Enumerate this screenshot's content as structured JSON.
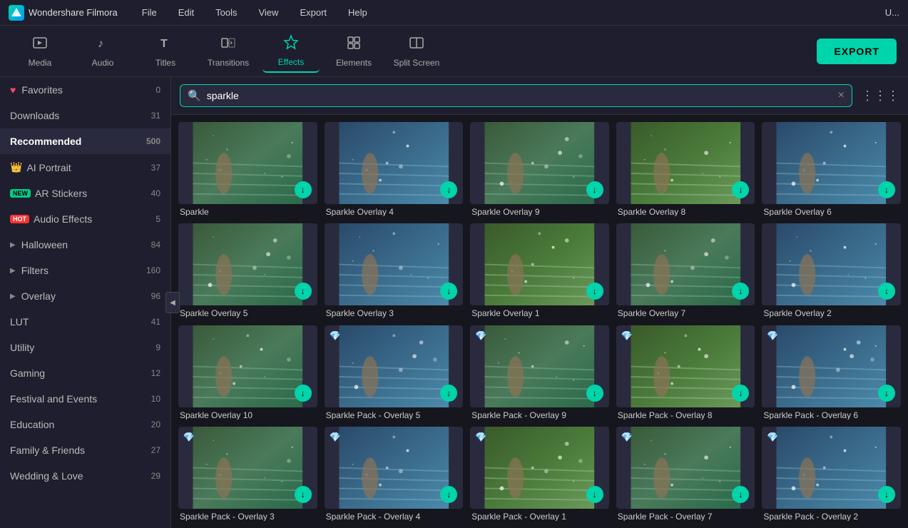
{
  "app": {
    "name": "Wondershare Filmora",
    "logo_text": "F"
  },
  "menu": {
    "items": [
      "File",
      "Edit",
      "Tools",
      "View",
      "Export",
      "Help"
    ],
    "right_text": "U..."
  },
  "tabs": [
    {
      "id": "media",
      "label": "Media",
      "icon": "📁"
    },
    {
      "id": "audio",
      "label": "Audio",
      "icon": "🎵"
    },
    {
      "id": "titles",
      "label": "Titles",
      "icon": "T"
    },
    {
      "id": "transitions",
      "label": "Transitions",
      "icon": "✦"
    },
    {
      "id": "effects",
      "label": "Effects",
      "icon": "✦",
      "active": true
    },
    {
      "id": "elements",
      "label": "Elements",
      "icon": "⊞"
    },
    {
      "id": "split_screen",
      "label": "Split Screen",
      "icon": "⊟"
    }
  ],
  "export_label": "EXPORT",
  "search": {
    "placeholder": "Search",
    "value": "sparkle",
    "clear_icon": "×",
    "grid_icon": "⋮⋮⋮"
  },
  "sidebar": {
    "items": [
      {
        "id": "favorites",
        "label": "Favorites",
        "count": "0",
        "icon_type": "heart"
      },
      {
        "id": "downloads",
        "label": "Downloads",
        "count": "31",
        "icon_type": "none"
      },
      {
        "id": "recommended",
        "label": "Recommended",
        "count": "500",
        "icon_type": "none",
        "active": true
      },
      {
        "id": "ai_portrait",
        "label": "AI Portrait",
        "count": "37",
        "icon_type": "crown"
      },
      {
        "id": "ar_stickers",
        "label": "AR Stickers",
        "count": "40",
        "icon_type": "new"
      },
      {
        "id": "audio_effects",
        "label": "Audio Effects",
        "count": "5",
        "icon_type": "hot"
      },
      {
        "id": "halloween",
        "label": "Halloween",
        "count": "84",
        "icon_type": "arrow"
      },
      {
        "id": "filters",
        "label": "Filters",
        "count": "160",
        "icon_type": "arrow"
      },
      {
        "id": "overlay",
        "label": "Overlay",
        "count": "96",
        "icon_type": "arrow"
      },
      {
        "id": "lut",
        "label": "LUT",
        "count": "41",
        "icon_type": "none"
      },
      {
        "id": "utility",
        "label": "Utility",
        "count": "9",
        "icon_type": "none"
      },
      {
        "id": "gaming",
        "label": "Gaming",
        "count": "12",
        "icon_type": "none"
      },
      {
        "id": "festival_events",
        "label": "Festival and Events",
        "count": "10",
        "icon_type": "none"
      },
      {
        "id": "education",
        "label": "Education",
        "count": "20",
        "icon_type": "none"
      },
      {
        "id": "family_friends",
        "label": "Family & Friends",
        "count": "27",
        "icon_type": "none"
      },
      {
        "id": "wedding_love",
        "label": "Wedding & Love",
        "count": "29",
        "icon_type": "none"
      }
    ]
  },
  "grid": {
    "items": [
      {
        "id": 1,
        "label": "Sparkle",
        "premium": false,
        "variant": "var1",
        "download": true
      },
      {
        "id": 2,
        "label": "Sparkle Overlay 4",
        "premium": false,
        "variant": "var2",
        "download": true
      },
      {
        "id": 3,
        "label": "Sparkle Overlay 9",
        "premium": false,
        "variant": "var1",
        "download": true
      },
      {
        "id": 4,
        "label": "Sparkle Overlay 8",
        "premium": false,
        "variant": "var3",
        "download": true
      },
      {
        "id": 5,
        "label": "Sparkle Overlay 6",
        "premium": false,
        "variant": "var2",
        "download": true
      },
      {
        "id": 6,
        "label": "Sparkle Overlay 5",
        "premium": false,
        "variant": "var1",
        "download": true
      },
      {
        "id": 7,
        "label": "Sparkle Overlay 3",
        "premium": false,
        "variant": "var2",
        "download": true
      },
      {
        "id": 8,
        "label": "Sparkle Overlay 1",
        "premium": false,
        "variant": "var3",
        "download": true
      },
      {
        "id": 9,
        "label": "Sparkle Overlay 7",
        "premium": false,
        "variant": "var1",
        "download": true
      },
      {
        "id": 10,
        "label": "Sparkle Overlay 2",
        "premium": false,
        "variant": "var2",
        "download": true
      },
      {
        "id": 11,
        "label": "Sparkle Overlay 10",
        "premium": false,
        "variant": "var1",
        "download": true
      },
      {
        "id": 12,
        "label": "Sparkle Pack - Overlay 5",
        "premium": true,
        "variant": "var2",
        "download": true
      },
      {
        "id": 13,
        "label": "Sparkle Pack - Overlay 9",
        "premium": true,
        "variant": "var1",
        "download": true
      },
      {
        "id": 14,
        "label": "Sparkle Pack - Overlay 8",
        "premium": true,
        "variant": "var3",
        "download": true
      },
      {
        "id": 15,
        "label": "Sparkle Pack - Overlay 6",
        "premium": true,
        "variant": "var2",
        "download": true
      },
      {
        "id": 16,
        "label": "Sparkle Pack - Overlay 3",
        "premium": true,
        "variant": "var1",
        "download": true
      },
      {
        "id": 17,
        "label": "Sparkle Pack - Overlay 4",
        "premium": true,
        "variant": "var2",
        "download": true
      },
      {
        "id": 18,
        "label": "Sparkle Pack - Overlay 1",
        "premium": true,
        "variant": "var3",
        "download": true
      },
      {
        "id": 19,
        "label": "Sparkle Pack - Overlay 7",
        "premium": true,
        "variant": "var1",
        "download": true
      },
      {
        "id": 20,
        "label": "Sparkle Pack - Overlay 2",
        "premium": true,
        "variant": "var2",
        "download": true
      }
    ]
  },
  "colors": {
    "accent": "#00d4aa",
    "premium_gem": "💎",
    "bg_dark": "#1e1e2e"
  }
}
